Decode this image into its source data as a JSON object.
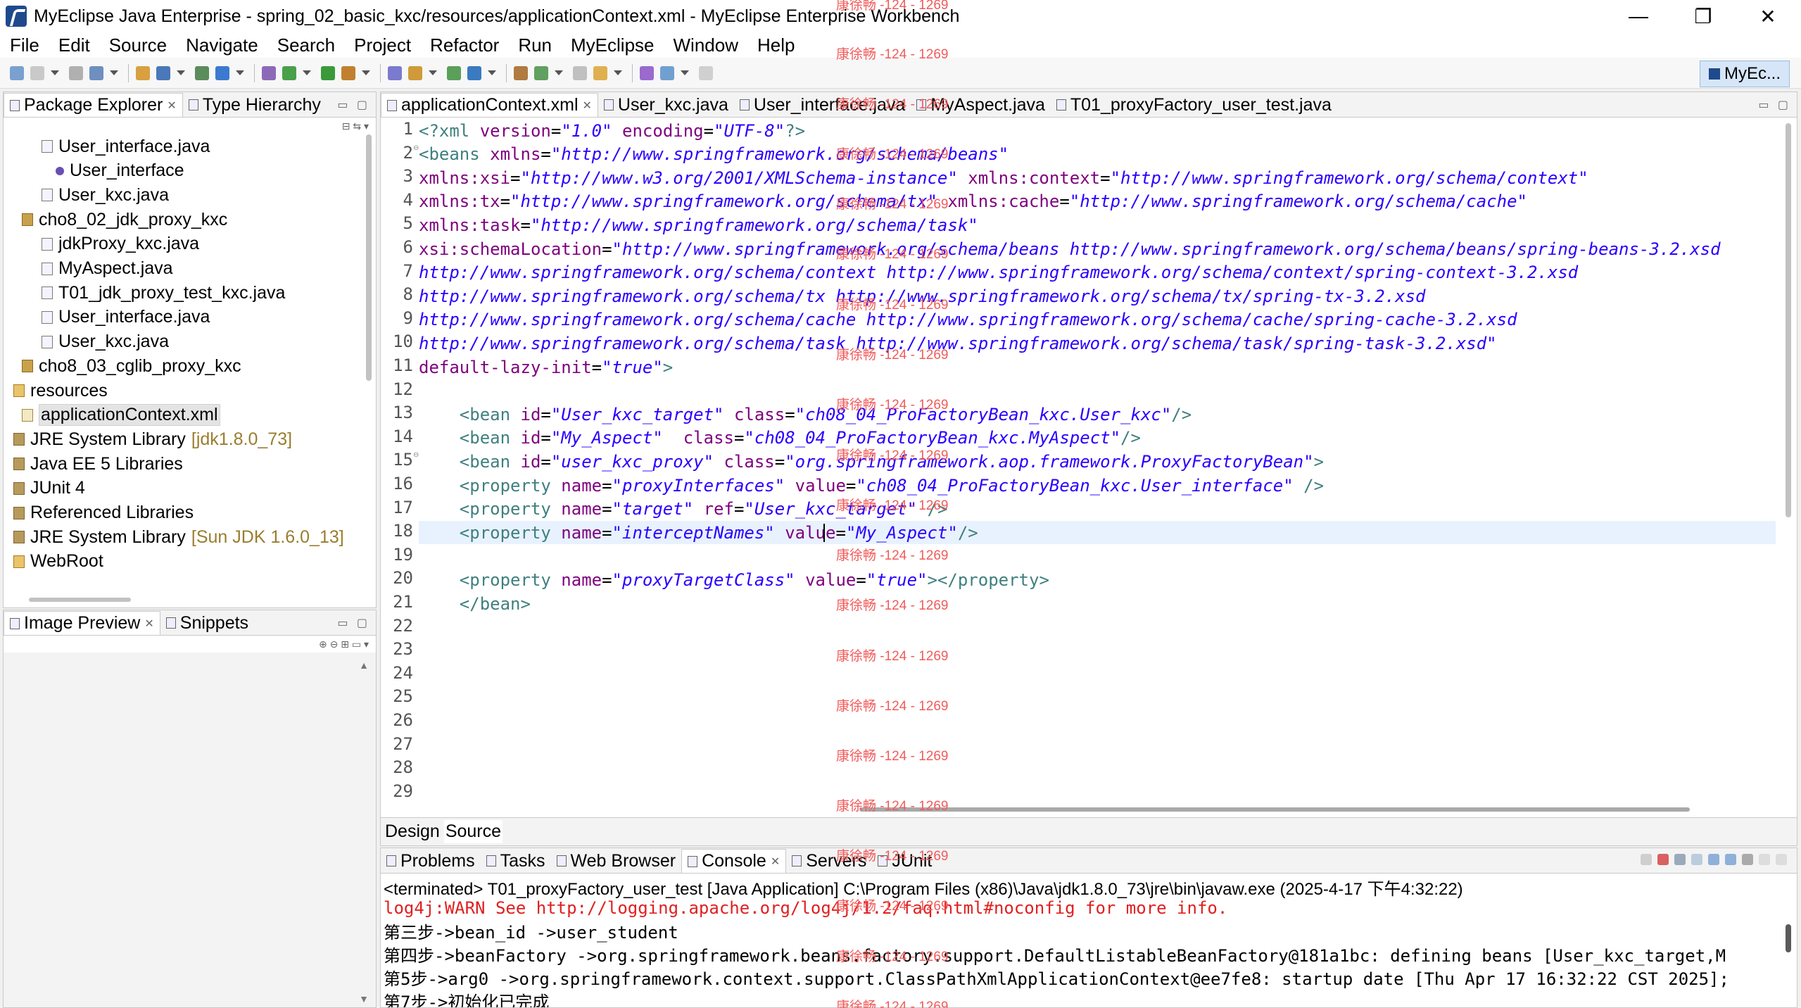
{
  "window": {
    "title": "MyEclipse Java Enterprise - spring_02_basic_kxc/resources/applicationContext.xml - MyEclipse Enterprise Workbench",
    "controls": {
      "minimize": "—",
      "maximize": "❐",
      "close": "✕"
    }
  },
  "menu": [
    "File",
    "Edit",
    "Source",
    "Navigate",
    "Search",
    "Project",
    "Refactor",
    "Run",
    "MyEclipse",
    "Window",
    "Help"
  ],
  "perspective": {
    "label": "MyEc..."
  },
  "package_explorer": {
    "tabs": [
      {
        "label": "Package Explorer",
        "active": true
      },
      {
        "label": "Type Hierarchy",
        "active": false
      }
    ],
    "tree": [
      {
        "label": "User_interface.java",
        "icon": "java-file",
        "indent": 3,
        "decoration": ""
      },
      {
        "label": "User_interface",
        "icon": "interface",
        "indent": 4,
        "decoration": ""
      },
      {
        "label": "User_kxc.java",
        "icon": "java-file",
        "indent": 3,
        "decoration": ""
      },
      {
        "label": "cho8_02_jdk_proxy_kxc",
        "icon": "package",
        "indent": 2,
        "decoration": ""
      },
      {
        "label": "jdkProxy_kxc.java",
        "icon": "java-file",
        "indent": 3,
        "decoration": ""
      },
      {
        "label": "MyAspect.java",
        "icon": "java-file",
        "indent": 3,
        "decoration": ""
      },
      {
        "label": "T01_jdk_proxy_test_kxc.java",
        "icon": "java-file",
        "indent": 3,
        "decoration": ""
      },
      {
        "label": "User_interface.java",
        "icon": "java-file",
        "indent": 3,
        "decoration": ""
      },
      {
        "label": "User_kxc.java",
        "icon": "java-file",
        "indent": 3,
        "decoration": ""
      },
      {
        "label": "cho8_03_cglib_proxy_kxc",
        "icon": "package",
        "indent": 2,
        "decoration": ""
      },
      {
        "label": "resources",
        "icon": "source-folder",
        "indent": 1,
        "decoration": ""
      },
      {
        "label": "applicationContext.xml",
        "icon": "xml-file",
        "indent": 2,
        "decoration": "",
        "selected": true
      },
      {
        "label": "JRE System Library",
        "icon": "library",
        "indent": 1,
        "decoration": "[jdk1.8.0_73]"
      },
      {
        "label": "Java EE 5 Libraries",
        "icon": "library",
        "indent": 1,
        "decoration": ""
      },
      {
        "label": "JUnit 4",
        "icon": "library",
        "indent": 1,
        "decoration": ""
      },
      {
        "label": "Referenced Libraries",
        "icon": "library",
        "indent": 1,
        "decoration": ""
      },
      {
        "label": "JRE System Library",
        "icon": "library",
        "indent": 1,
        "decoration": "[Sun JDK 1.6.0_13]"
      },
      {
        "label": "WebRoot",
        "icon": "folder",
        "indent": 1,
        "decoration": ""
      }
    ]
  },
  "image_preview": {
    "tabs": [
      {
        "label": "Image Preview",
        "active": true
      },
      {
        "label": "Snippets",
        "active": false
      }
    ]
  },
  "editor": {
    "tabs": [
      {
        "label": "applicationContext.xml",
        "active": true
      },
      {
        "label": "User_kxc.java",
        "active": false
      },
      {
        "label": "User_interface.java",
        "active": false
      },
      {
        "label": "MyAspect.java",
        "active": false
      },
      {
        "label": "T01_proxyFactory_user_test.java",
        "active": false
      }
    ],
    "current_line": 18,
    "lines": [
      {
        "n": "1",
        "tokens": [
          [
            "t-tag",
            "<?xml "
          ],
          [
            "t-attr",
            "version"
          ],
          [
            "t-plain",
            "="
          ],
          [
            "t-str",
            "\"1.0\""
          ],
          [
            "t-plain",
            " "
          ],
          [
            "t-attr",
            "encoding"
          ],
          [
            "t-plain",
            "="
          ],
          [
            "t-str",
            "\"UTF-8\""
          ],
          [
            "t-tag",
            "?>"
          ]
        ]
      },
      {
        "n": "2",
        "fold": true,
        "tokens": [
          [
            "t-tag",
            "<beans "
          ],
          [
            "t-attr",
            "xmlns"
          ],
          [
            "t-plain",
            "="
          ],
          [
            "t-str",
            "\"http://www.springframework.org/schema/beans\""
          ]
        ]
      },
      {
        "n": "3",
        "tokens": [
          [
            "t-attr",
            "xmlns:xsi"
          ],
          [
            "t-plain",
            "="
          ],
          [
            "t-str",
            "\"http://www.w3.org/2001/XMLSchema-instance\""
          ],
          [
            "t-plain",
            " "
          ],
          [
            "t-attr",
            "xmlns:context"
          ],
          [
            "t-plain",
            "="
          ],
          [
            "t-str",
            "\"http://www.springframework.org/schema/context\""
          ]
        ]
      },
      {
        "n": "4",
        "tokens": [
          [
            "t-attr",
            "xmlns:tx"
          ],
          [
            "t-plain",
            "="
          ],
          [
            "t-str",
            "\"http://www.springframework.org/schema/tx\""
          ],
          [
            "t-plain",
            " "
          ],
          [
            "t-attr",
            "xmlns:cache"
          ],
          [
            "t-plain",
            "="
          ],
          [
            "t-str",
            "\"http://www.springframework.org/schema/cache\""
          ]
        ]
      },
      {
        "n": "5",
        "tokens": [
          [
            "t-attr",
            "xmlns:task"
          ],
          [
            "t-plain",
            "="
          ],
          [
            "t-str",
            "\"http://www.springframework.org/schema/task\""
          ]
        ]
      },
      {
        "n": "6",
        "tokens": [
          [
            "t-attr",
            "xsi:schemaLocation"
          ],
          [
            "t-plain",
            "="
          ],
          [
            "t-str",
            "\"http://www.springframework.org/schema/beans http://www.springframework.org/schema/beans/spring-beans-3.2.xsd"
          ]
        ]
      },
      {
        "n": "7",
        "tokens": [
          [
            "t-str",
            "http://www.springframework.org/schema/context http://www.springframework.org/schema/context/spring-context-3.2.xsd"
          ]
        ]
      },
      {
        "n": "8",
        "tokens": [
          [
            "t-str",
            "http://www.springframework.org/schema/tx http://www.springframework.org/schema/tx/spring-tx-3.2.xsd"
          ]
        ]
      },
      {
        "n": "9",
        "tokens": [
          [
            "t-str",
            "http://www.springframework.org/schema/cache http://www.springframework.org/schema/cache/spring-cache-3.2.xsd"
          ]
        ]
      },
      {
        "n": "10",
        "tokens": [
          [
            "t-str",
            "http://www.springframework.org/schema/task http://www.springframework.org/schema/task/spring-task-3.2.xsd\""
          ]
        ]
      },
      {
        "n": "11",
        "tokens": [
          [
            "t-attr",
            "default-lazy-init"
          ],
          [
            "t-plain",
            "="
          ],
          [
            "t-str",
            "\"true\""
          ],
          [
            "t-tag",
            ">"
          ]
        ]
      },
      {
        "n": "12",
        "tokens": []
      },
      {
        "n": "13",
        "tokens": [
          [
            "t-plain",
            "    "
          ],
          [
            "t-tag",
            "<bean "
          ],
          [
            "t-attr",
            "id"
          ],
          [
            "t-plain",
            "="
          ],
          [
            "t-str",
            "\"User_kxc_target\""
          ],
          [
            "t-plain",
            " "
          ],
          [
            "t-attr",
            "class"
          ],
          [
            "t-plain",
            "="
          ],
          [
            "t-str",
            "\"ch08_04_ProFactoryBean_kxc.User_kxc\""
          ],
          [
            "t-tag",
            "/>"
          ]
        ]
      },
      {
        "n": "14",
        "tokens": [
          [
            "t-plain",
            "    "
          ],
          [
            "t-tag",
            "<bean "
          ],
          [
            "t-attr",
            "id"
          ],
          [
            "t-plain",
            "="
          ],
          [
            "t-str",
            "\"My_Aspect\""
          ],
          [
            "t-plain",
            "  "
          ],
          [
            "t-attr",
            "class"
          ],
          [
            "t-plain",
            "="
          ],
          [
            "t-str",
            "\"ch08_04_ProFactoryBean_kxc.MyAspect\""
          ],
          [
            "t-tag",
            "/>"
          ]
        ]
      },
      {
        "n": "15",
        "fold": true,
        "tokens": [
          [
            "t-plain",
            "    "
          ],
          [
            "t-tag",
            "<bean "
          ],
          [
            "t-attr",
            "id"
          ],
          [
            "t-plain",
            "="
          ],
          [
            "t-str",
            "\"user_kxc_proxy\""
          ],
          [
            "t-plain",
            " "
          ],
          [
            "t-attr",
            "class"
          ],
          [
            "t-plain",
            "="
          ],
          [
            "t-str",
            "\"org.springframework.aop.framework.ProxyFactoryBean\""
          ],
          [
            "t-tag",
            ">"
          ]
        ]
      },
      {
        "n": "16",
        "tokens": [
          [
            "t-plain",
            "    "
          ],
          [
            "t-tag",
            "<property "
          ],
          [
            "t-attr",
            "name"
          ],
          [
            "t-plain",
            "="
          ],
          [
            "t-str",
            "\"proxyInterfaces\""
          ],
          [
            "t-plain",
            " "
          ],
          [
            "t-attr",
            "value"
          ],
          [
            "t-plain",
            "="
          ],
          [
            "t-str",
            "\"ch08_04_ProFactoryBean_kxc.User_interface\""
          ],
          [
            "t-plain",
            " "
          ],
          [
            "t-tag",
            "/>"
          ]
        ]
      },
      {
        "n": "17",
        "tokens": [
          [
            "t-plain",
            "    "
          ],
          [
            "t-tag",
            "<property "
          ],
          [
            "t-attr",
            "name"
          ],
          [
            "t-plain",
            "="
          ],
          [
            "t-str",
            "\"target\""
          ],
          [
            "t-plain",
            " "
          ],
          [
            "t-attr",
            "ref"
          ],
          [
            "t-plain",
            "="
          ],
          [
            "t-str",
            "\"User_kxc_target\""
          ],
          [
            "t-plain",
            " "
          ],
          [
            "t-tag",
            "/>"
          ]
        ]
      },
      {
        "n": "18",
        "tokens": [
          [
            "t-plain",
            "    "
          ],
          [
            "t-tag",
            "<property "
          ],
          [
            "t-attr",
            "name"
          ],
          [
            "t-plain",
            "="
          ],
          [
            "t-str",
            "\"interceptNames\""
          ],
          [
            "t-plain",
            " "
          ],
          [
            "t-attr",
            "value"
          ],
          [
            "t-plain",
            "="
          ],
          [
            "t-str",
            "\"My_Aspect\""
          ],
          [
            "t-tag",
            "/>"
          ]
        ]
      },
      {
        "n": "19",
        "tokens": []
      },
      {
        "n": "20",
        "tokens": [
          [
            "t-plain",
            "    "
          ],
          [
            "t-tag",
            "<property "
          ],
          [
            "t-attr",
            "name"
          ],
          [
            "t-plain",
            "="
          ],
          [
            "t-str",
            "\"proxyTargetClass\""
          ],
          [
            "t-plain",
            " "
          ],
          [
            "t-attr",
            "value"
          ],
          [
            "t-plain",
            "="
          ],
          [
            "t-str",
            "\"true\""
          ],
          [
            "t-tag",
            "></property>"
          ]
        ]
      },
      {
        "n": "21",
        "tokens": [
          [
            "t-plain",
            "    "
          ],
          [
            "t-tag",
            "</bean>"
          ]
        ]
      },
      {
        "n": "22",
        "tokens": []
      },
      {
        "n": "23",
        "tokens": []
      },
      {
        "n": "24",
        "tokens": []
      },
      {
        "n": "25",
        "tokens": []
      },
      {
        "n": "26",
        "tokens": []
      },
      {
        "n": "27",
        "tokens": []
      },
      {
        "n": "28",
        "tokens": []
      },
      {
        "n": "29",
        "tokens": []
      }
    ],
    "bottom_tabs": [
      {
        "label": "Design",
        "active": false
      },
      {
        "label": "Source",
        "active": true
      }
    ]
  },
  "console": {
    "tabs": [
      {
        "label": "Problems",
        "active": false
      },
      {
        "label": "Tasks",
        "active": false
      },
      {
        "label": "Web Browser",
        "active": false
      },
      {
        "label": "Console",
        "active": true
      },
      {
        "label": "Servers",
        "active": false
      },
      {
        "label": "JUnit",
        "active": false
      }
    ],
    "header": "<terminated> T01_proxyFactory_user_test [Java Application] C:\\Program Files (x86)\\Java\\jdk1.8.0_73\\jre\\bin\\javaw.exe (2025-4-17 下午4:32:22)",
    "lines": [
      {
        "text": "log4j:WARN See http://logging.apache.org/log4j/1.2/faq.html#noconfig for more info.",
        "style": "warn"
      },
      {
        "text": "第三步->bean_id ->user_student",
        "style": "plain"
      },
      {
        "text": "第四步->beanFactory ->org.springframework.beans.factory.support.DefaultListableBeanFactory@181a1bc: defining beans [User_kxc_target,M",
        "style": "plain"
      },
      {
        "text": "第5步->arg0 ->org.springframework.context.support.ClassPathXmlApplicationContext@ee7fe8: startup date [Thu Apr 17 16:32:22 CST 2025];",
        "style": "plain"
      },
      {
        "text": "第7步->初始化已完成",
        "style": "plain"
      }
    ]
  },
  "watermark": {
    "text": "康徐畅 -124 - 1269",
    "color": "#f25a5a"
  }
}
